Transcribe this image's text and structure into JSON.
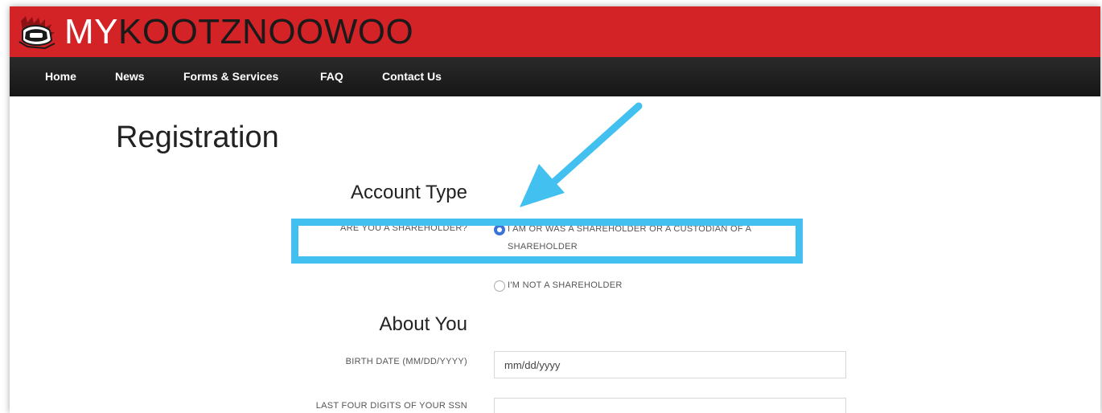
{
  "brand": {
    "title_part1": "MY",
    "title_part2": "KOOTZNOOWOO"
  },
  "nav": {
    "items": [
      "Home",
      "News",
      "Forms & Services",
      "FAQ",
      "Contact Us"
    ]
  },
  "page": {
    "title": "Registration"
  },
  "account_type": {
    "heading": "Account Type",
    "question_label": "ARE YOU A SHAREHOLDER?",
    "option_shareholder": "I AM OR WAS A SHAREHOLDER OR A CUSTODIAN OF A SHAREHOLDER",
    "option_not_shareholder": "I'M NOT A SHAREHOLDER",
    "selected": "shareholder"
  },
  "about_you": {
    "heading": "About You",
    "birth_date_label": "BIRTH DATE (MM/DD/YYYY)",
    "birth_date_placeholder": "mm/dd/yyyy",
    "ssn_label": "LAST FOUR DIGITS OF YOUR SSN",
    "ssn_value": ""
  },
  "colors": {
    "brand_red": "#d32327",
    "nav_dark": "#1c1c1c",
    "highlight": "#42c0ef",
    "radio_selected": "#3a74d8"
  },
  "icons": {
    "logo": "tribal-logo-icon",
    "annotation_arrow": "arrow-icon"
  }
}
